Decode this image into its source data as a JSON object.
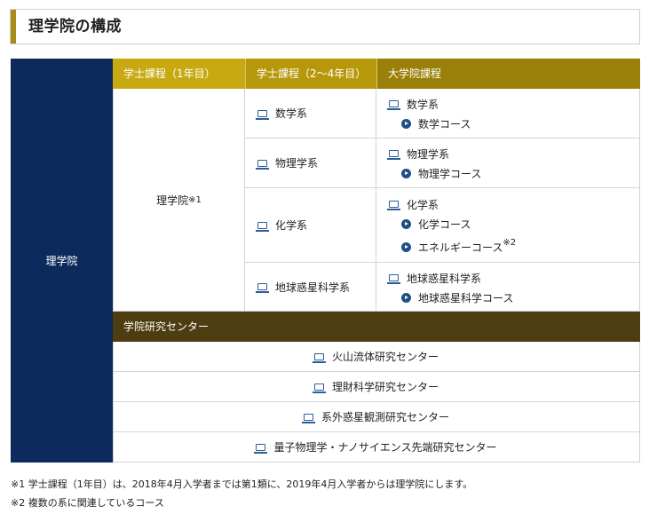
{
  "page_title": "理学院の構成",
  "left_label": "理学院",
  "headers": {
    "undergrad_first": "学士課程（1年目）",
    "undergrad_later": "学士課程（2～4年目）",
    "graduate": "大学院課程"
  },
  "first_year": {
    "label": "理学院",
    "note": "※1"
  },
  "departments": [
    {
      "name": "数学系",
      "grad_dept": "数学系",
      "courses": [
        {
          "name": "数学コース"
        }
      ]
    },
    {
      "name": "物理学系",
      "grad_dept": "物理学系",
      "courses": [
        {
          "name": "物理学コース"
        }
      ]
    },
    {
      "name": "化学系",
      "grad_dept": "化学系",
      "courses": [
        {
          "name": "化学コース"
        },
        {
          "name": "エネルギーコース",
          "note": "※2"
        }
      ]
    },
    {
      "name": "地球惑星科学系",
      "grad_dept": "地球惑星科学系",
      "courses": [
        {
          "name": "地球惑星科学コース"
        }
      ]
    }
  ],
  "centers_header": "学院研究センター",
  "centers": [
    {
      "name": "火山流体研究センター"
    },
    {
      "name": "理財科学研究センター"
    },
    {
      "name": "系外惑星観測研究センター"
    },
    {
      "name": "量子物理学・ナノサイエンス先端研究センター"
    }
  ],
  "footnotes": [
    "※1 学士課程（1年目）は、2018年4月入学者までは第1類に、2019年4月入学者からは理学院にします。",
    "※2 複数の系に関連しているコース"
  ],
  "colors": {
    "accent": "#a88c1a",
    "left_col": "#0c2a5c",
    "header_1": "#c8a911",
    "header_2": "#b7980a",
    "header_3": "#9a7f08",
    "center_header": "#4e3d10",
    "icon": "#2b5e98"
  }
}
